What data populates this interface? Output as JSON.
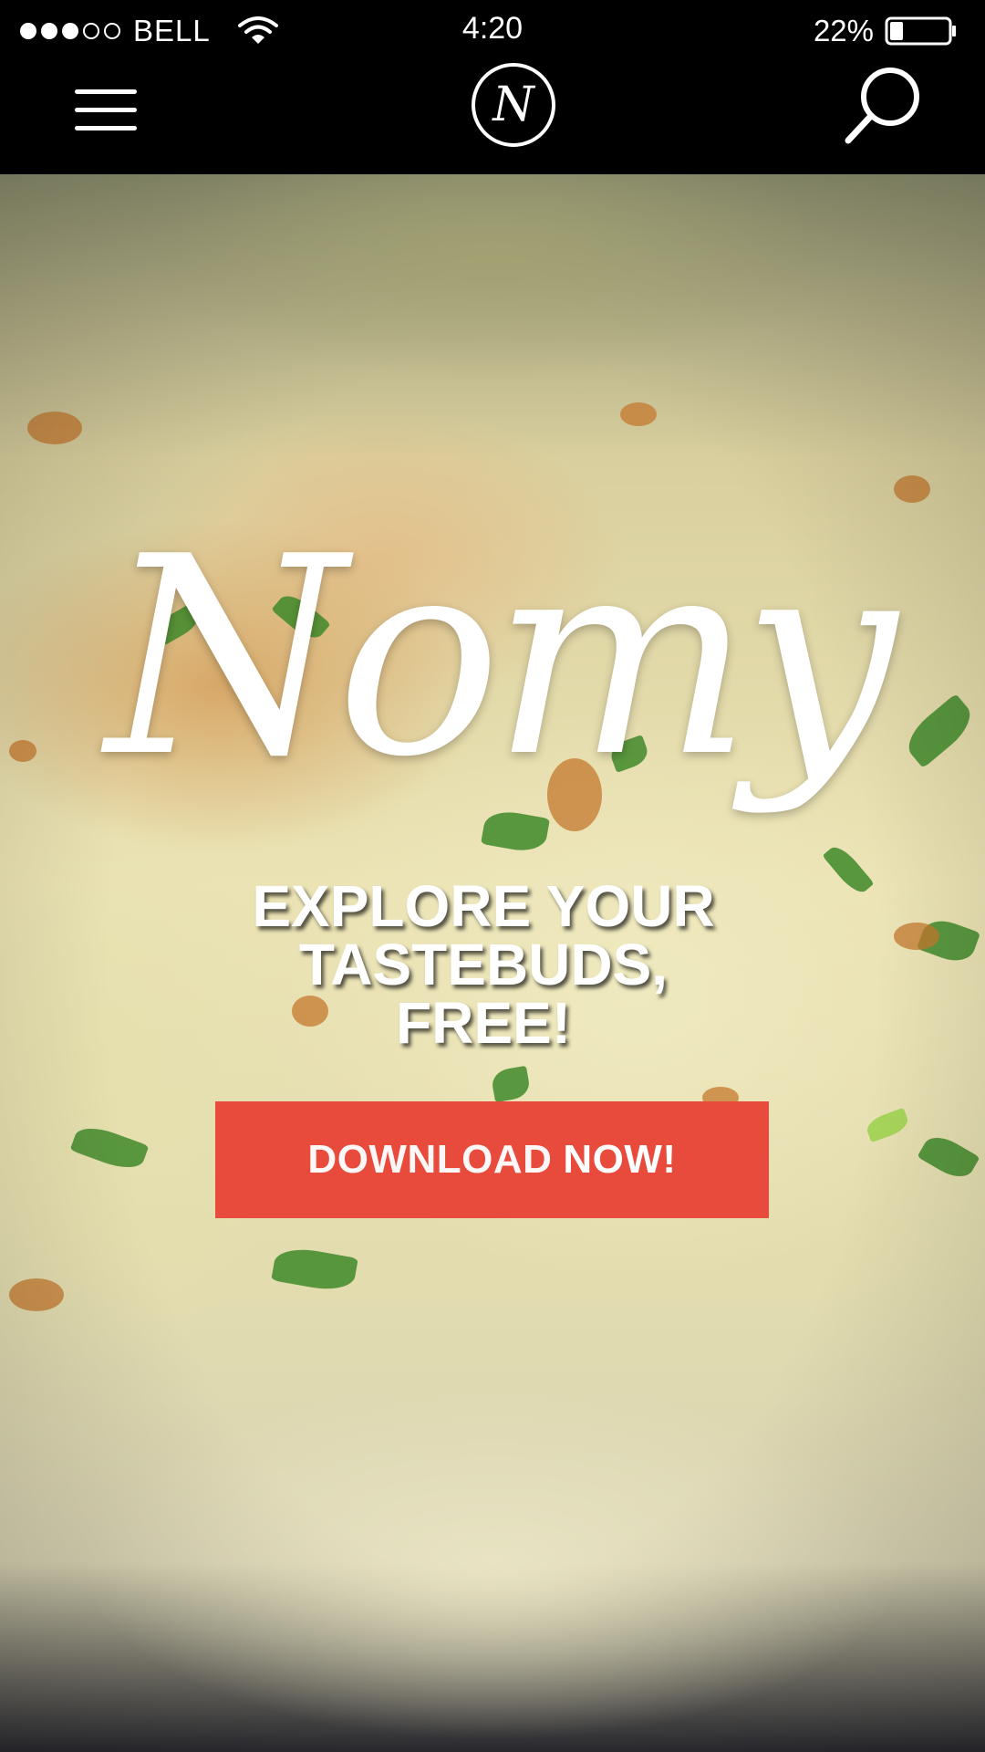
{
  "status_bar": {
    "carrier": "BELL",
    "time": "4:20",
    "battery_percent": "22%",
    "battery_level": 0.22,
    "signal_bars_filled": 3,
    "signal_bars_total": 5
  },
  "nav": {
    "logo_letter": "N"
  },
  "hero": {
    "brand_name": "Nomy",
    "tagline_lines": [
      "EXPLORE YOUR",
      "TASTEBUDS,",
      "FREE!"
    ],
    "cta_part1": "DOWNLOAD",
    "cta_part2": "NOW!"
  },
  "colors": {
    "cta": "#e84b3c",
    "bar": "#000000",
    "text": "#ffffff"
  },
  "icons": [
    "hamburger-menu-icon",
    "logo-badge-icon",
    "search-icon",
    "wifi-icon",
    "battery-icon"
  ]
}
